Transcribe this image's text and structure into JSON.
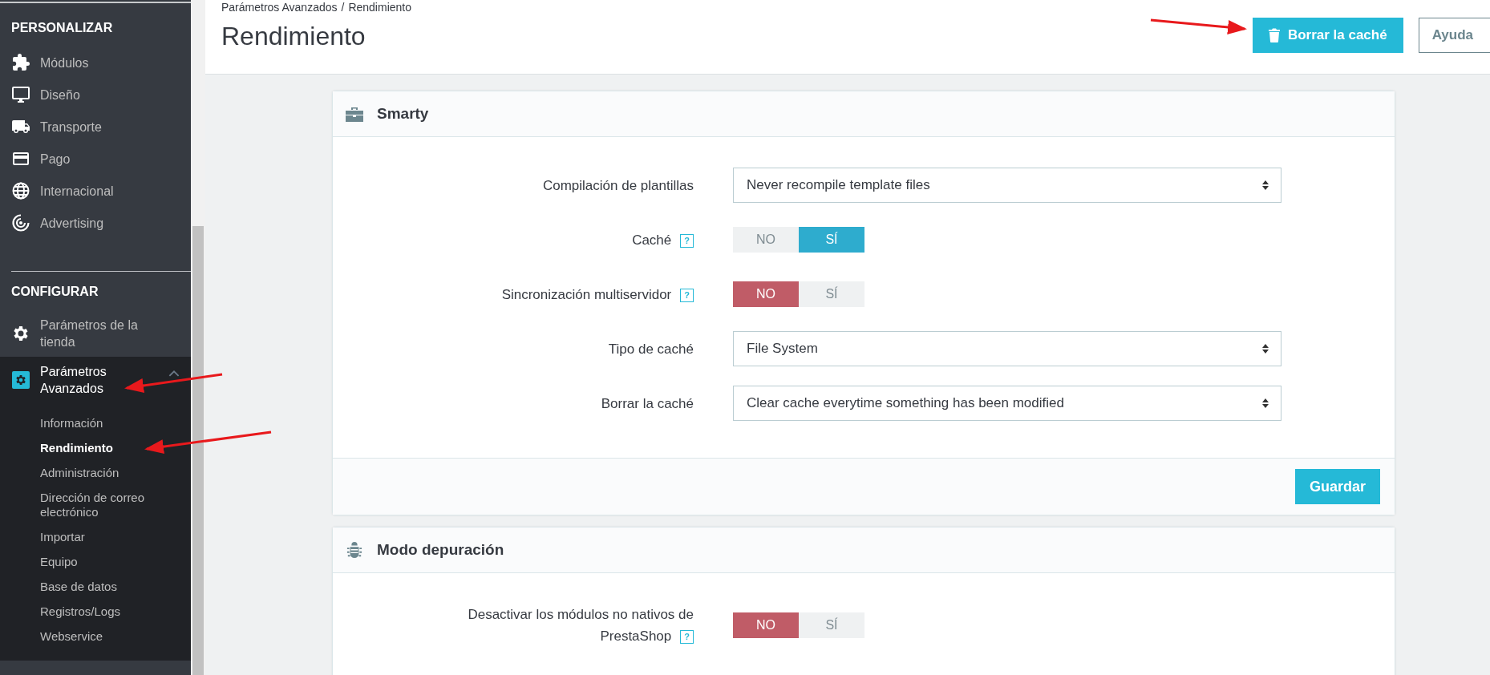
{
  "sidebar": {
    "sections": [
      {
        "title": "PERSONALIZAR",
        "items": [
          {
            "label": "Módulos",
            "selected": false,
            "expanded": false
          },
          {
            "label": "Diseño",
            "selected": false,
            "expanded": false
          },
          {
            "label": "Transporte",
            "selected": false,
            "expanded": false
          },
          {
            "label": "Pago",
            "selected": false,
            "expanded": false
          },
          {
            "label": "Internacional",
            "selected": false,
            "expanded": false
          },
          {
            "label": "Advertising",
            "selected": false,
            "expanded": false
          }
        ]
      },
      {
        "title": "CONFIGURAR",
        "items": [
          {
            "label": "Parámetros de la tienda",
            "selected": false,
            "expanded": false
          },
          {
            "label": "Parámetros Avanzados",
            "selected": true,
            "expanded": true,
            "children": [
              {
                "label": "Información",
                "selected": false
              },
              {
                "label": "Rendimiento",
                "selected": true
              },
              {
                "label": "Administración",
                "selected": false
              },
              {
                "label": "Dirección de correo electrónico",
                "selected": false
              },
              {
                "label": "Importar",
                "selected": false
              },
              {
                "label": "Equipo",
                "selected": false
              },
              {
                "label": "Base de datos",
                "selected": false
              },
              {
                "label": "Registros/Logs",
                "selected": false
              },
              {
                "label": "Webservice",
                "selected": false
              }
            ]
          }
        ]
      }
    ]
  },
  "header": {
    "breadcrumb": [
      "Parámetros Avanzados",
      "/",
      "Rendimiento"
    ],
    "title": "Rendimiento",
    "clear_button": "Borrar la caché",
    "help_button": "Ayuda"
  },
  "panels": [
    {
      "title": "Smarty",
      "rows": [
        {
          "kind": "select",
          "label": "Compilación de plantillas",
          "value": "Never recompile template files"
        },
        {
          "kind": "switch",
          "label": "Caché",
          "help": "?",
          "off_label": "NO",
          "on_label": "SÍ",
          "on": true
        },
        {
          "kind": "switch",
          "label": "Sincronización multiservidor",
          "help": "?",
          "off_label": "NO",
          "on_label": "SÍ",
          "on": false
        },
        {
          "kind": "select",
          "label": "Tipo de caché",
          "value": "File System"
        },
        {
          "kind": "select",
          "label": "Borrar la caché",
          "value": "Clear cache everytime something has been modified"
        }
      ],
      "save_button": "Guardar"
    },
    {
      "title": "Modo depuración",
      "rows": [
        {
          "kind": "switch",
          "label": "Desactivar los módulos no nativos de PrestaShop",
          "help": "?",
          "off_label": "NO",
          "on_label": "SÍ",
          "on": false
        }
      ]
    }
  ]
}
